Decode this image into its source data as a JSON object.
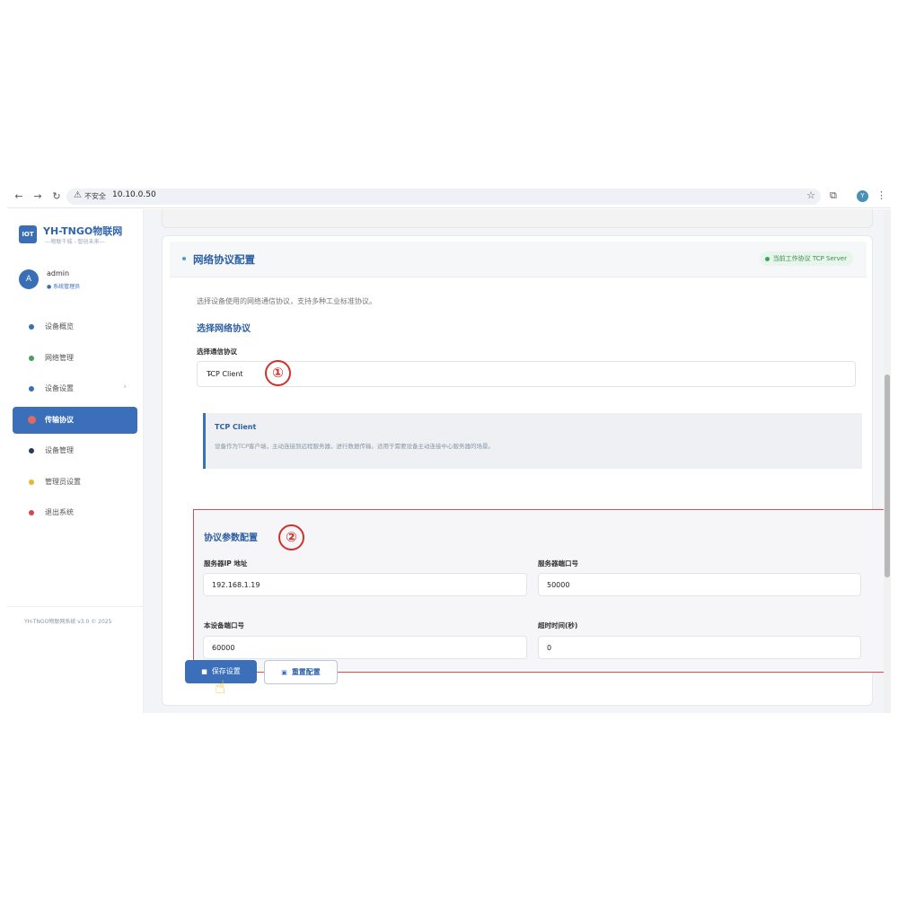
{
  "browser": {
    "back_icon": "←",
    "forward_icon": "→",
    "reload_icon": "↻",
    "warning_icon": "⚠",
    "insecure_label": "不安全",
    "url": "10.10.0.50",
    "star_icon": "☆",
    "extensions_icon": "⧉",
    "profile_initial": "Y",
    "menu_icon": "⋮"
  },
  "sidebar": {
    "logo": "IOT",
    "brand": "YH-TNGO物联网",
    "slogan": "---物联千城 - 智创未来---",
    "user": {
      "initial": "A",
      "name": "admin",
      "role": "● 系统管理员"
    },
    "items": [
      {
        "label": "设备概览",
        "color": "#3b6fba",
        "active": false
      },
      {
        "label": "网络管理",
        "color": "#4a9e5c",
        "active": false
      },
      {
        "label": "设备设置",
        "color": "#3b6fba",
        "active": false,
        "chevron": "›"
      },
      {
        "label": "传输协议",
        "color": "#e26a5a",
        "active": true
      },
      {
        "label": "设备管理",
        "color": "#2b3b55",
        "active": false
      },
      {
        "label": "管理员设置",
        "color": "#e5b830",
        "active": false
      },
      {
        "label": "退出系统",
        "color": "#d04a4a",
        "active": false
      }
    ],
    "footer": "YH-TNGO物联网系统 v3.0 © 2025"
  },
  "main": {
    "card_title": "网络协议配置",
    "status_badge": "当前工作协议  TCP Server",
    "description": "选择设备使用的网络通信协议，支持多种工业标准协议。",
    "section_title": "选择网络协议",
    "protocol_label": "选择通信协议",
    "protocol_value": "TCP Client",
    "protocol_caret": "⌄",
    "annotation_1": "①",
    "info_title": "TCP Client",
    "info_text": "设备作为TCP客户端，主动连接到远程服务器，进行数据传输。适用于需要设备主动连接中心服务器的场景。",
    "param_title": "协议参数配置",
    "annotation_2": "②",
    "fields": {
      "server_ip_label": "服务器IP 地址",
      "server_ip_value": "192.168.1.19",
      "server_port_label": "服务器端口号",
      "server_port_value": "50000",
      "local_port_label": "本设备端口号",
      "local_port_value": "60000",
      "timeout_label": "超时时间(秒)",
      "timeout_value": "0"
    },
    "save_button": "保存设置",
    "save_icon": "■",
    "reset_button": "重置配置",
    "reset_icon": "▣",
    "cursor_icon": "☝"
  }
}
